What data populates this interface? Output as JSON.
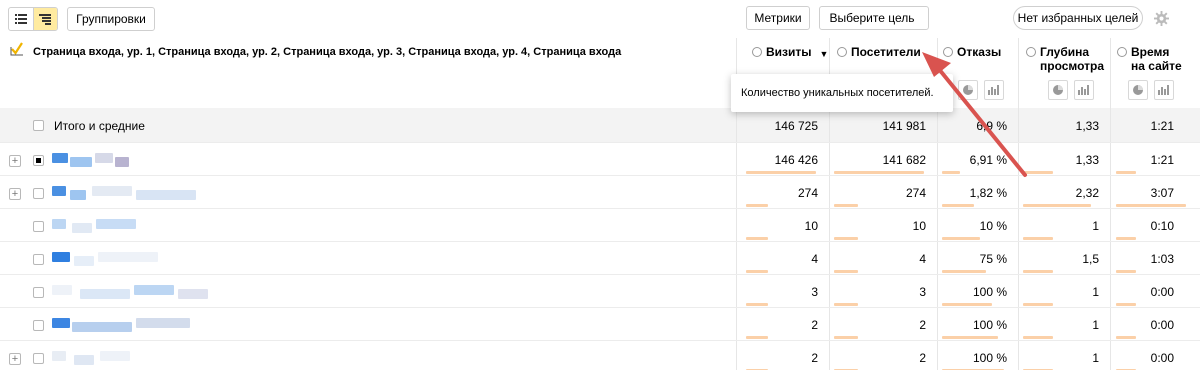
{
  "toolbar": {
    "groupings_label": "Группировки",
    "metrics_label": "Метрики",
    "goal_select_label": "Выберите цель",
    "favorites_label": "Нет избранных целей"
  },
  "grouping_title": "Страница входа, ур. 1, Страница входа, ур. 2, Страница входа, ур. 3, Страница входа, ур. 4, Страница входа",
  "columns": [
    {
      "label": "Визиты",
      "sort": "▼"
    },
    {
      "label": "Посетители"
    },
    {
      "label": "Отказы"
    },
    {
      "label": "Глубина\nпросмотра"
    },
    {
      "label": "Время\nна сайте"
    }
  ],
  "tooltip": "Количество уникальных посетителей.",
  "total": {
    "label": "Итого и средние",
    "visits": "146 725",
    "visitors": "141 981",
    "bounce": "6,9 %",
    "depth": "1,33",
    "time": "1:21"
  },
  "rows": [
    {
      "visits": "146 426",
      "visitors": "141 682",
      "bounce": "6,91 %",
      "depth": "1,33",
      "time": "1:21",
      "expand": true,
      "selected": true
    },
    {
      "visits": "274",
      "visitors": "274",
      "bounce": "1,82 %",
      "depth": "2,32",
      "time": "3:07",
      "expand": true,
      "selected": false
    },
    {
      "visits": "10",
      "visitors": "10",
      "bounce": "10 %",
      "depth": "1",
      "time": "0:10",
      "expand": false,
      "selected": false
    },
    {
      "visits": "4",
      "visitors": "4",
      "bounce": "75 %",
      "depth": "1,5",
      "time": "1:03",
      "expand": false,
      "selected": false
    },
    {
      "visits": "3",
      "visitors": "3",
      "bounce": "100 %",
      "depth": "1",
      "time": "0:00",
      "expand": false,
      "selected": false
    },
    {
      "visits": "2",
      "visitors": "2",
      "bounce": "100 %",
      "depth": "1",
      "time": "0:00",
      "expand": false,
      "selected": false
    },
    {
      "visits": "2",
      "visitors": "2",
      "bounce": "100 %",
      "depth": "1",
      "time": "0:00",
      "expand": true,
      "selected": false
    }
  ],
  "icons": {
    "list_view": "list-icon",
    "tree_view": "tree-icon",
    "settings": "gear-icon",
    "info": "info-icon",
    "pie": "pie-chart-icon",
    "bars": "bar-chart-icon",
    "dropdown": "chevron-down-icon"
  },
  "colors": {
    "accent": "#ffeba0",
    "bar": "#fbd0a8",
    "checkbox_checked": "#f0b400",
    "arrow": "#d9534f"
  }
}
